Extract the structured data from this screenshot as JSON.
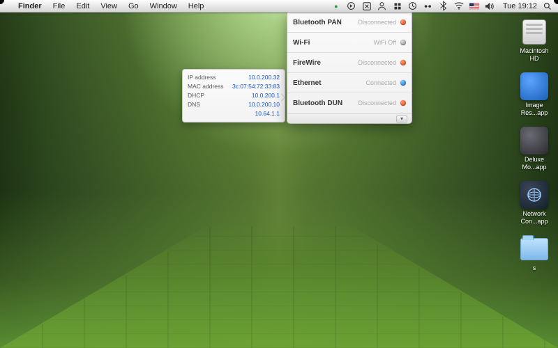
{
  "menubar": {
    "app": "Finder",
    "items": [
      "File",
      "Edit",
      "View",
      "Go",
      "Window",
      "Help"
    ],
    "clock": "Tue 19:12"
  },
  "network_menu": {
    "items": [
      {
        "name": "Bluetooth PAN",
        "status": "Disconnected",
        "dot": "red"
      },
      {
        "name": "Wi-Fi",
        "status": "WiFi Off",
        "dot": "gray"
      },
      {
        "name": "FireWire",
        "status": "Disconnected",
        "dot": "red"
      },
      {
        "name": "Ethernet",
        "status": "Connected",
        "dot": "blue"
      },
      {
        "name": "Bluetooth DUN",
        "status": "Disconnected",
        "dot": "red"
      }
    ]
  },
  "tooltip": {
    "rows": [
      {
        "k": "IP address",
        "v": "10.0.200.32"
      },
      {
        "k": "MAC address",
        "v": "3c:07:54:72:33:83"
      },
      {
        "k": "DHCP",
        "v": "10.0.200.1"
      },
      {
        "k": "DNS",
        "v": "10.0.200.10"
      },
      {
        "k": "",
        "v": "10.64.1.1"
      }
    ]
  },
  "desktop_icons": [
    {
      "label": "Macintosh HD",
      "kind": "hd"
    },
    {
      "label": "Image Res...app",
      "kind": "app-blue"
    },
    {
      "label": "Deluxe Mo...app",
      "kind": "app-dark"
    },
    {
      "label": "Network Con...app",
      "kind": "app-net"
    },
    {
      "label": "s",
      "kind": "folder"
    }
  ]
}
